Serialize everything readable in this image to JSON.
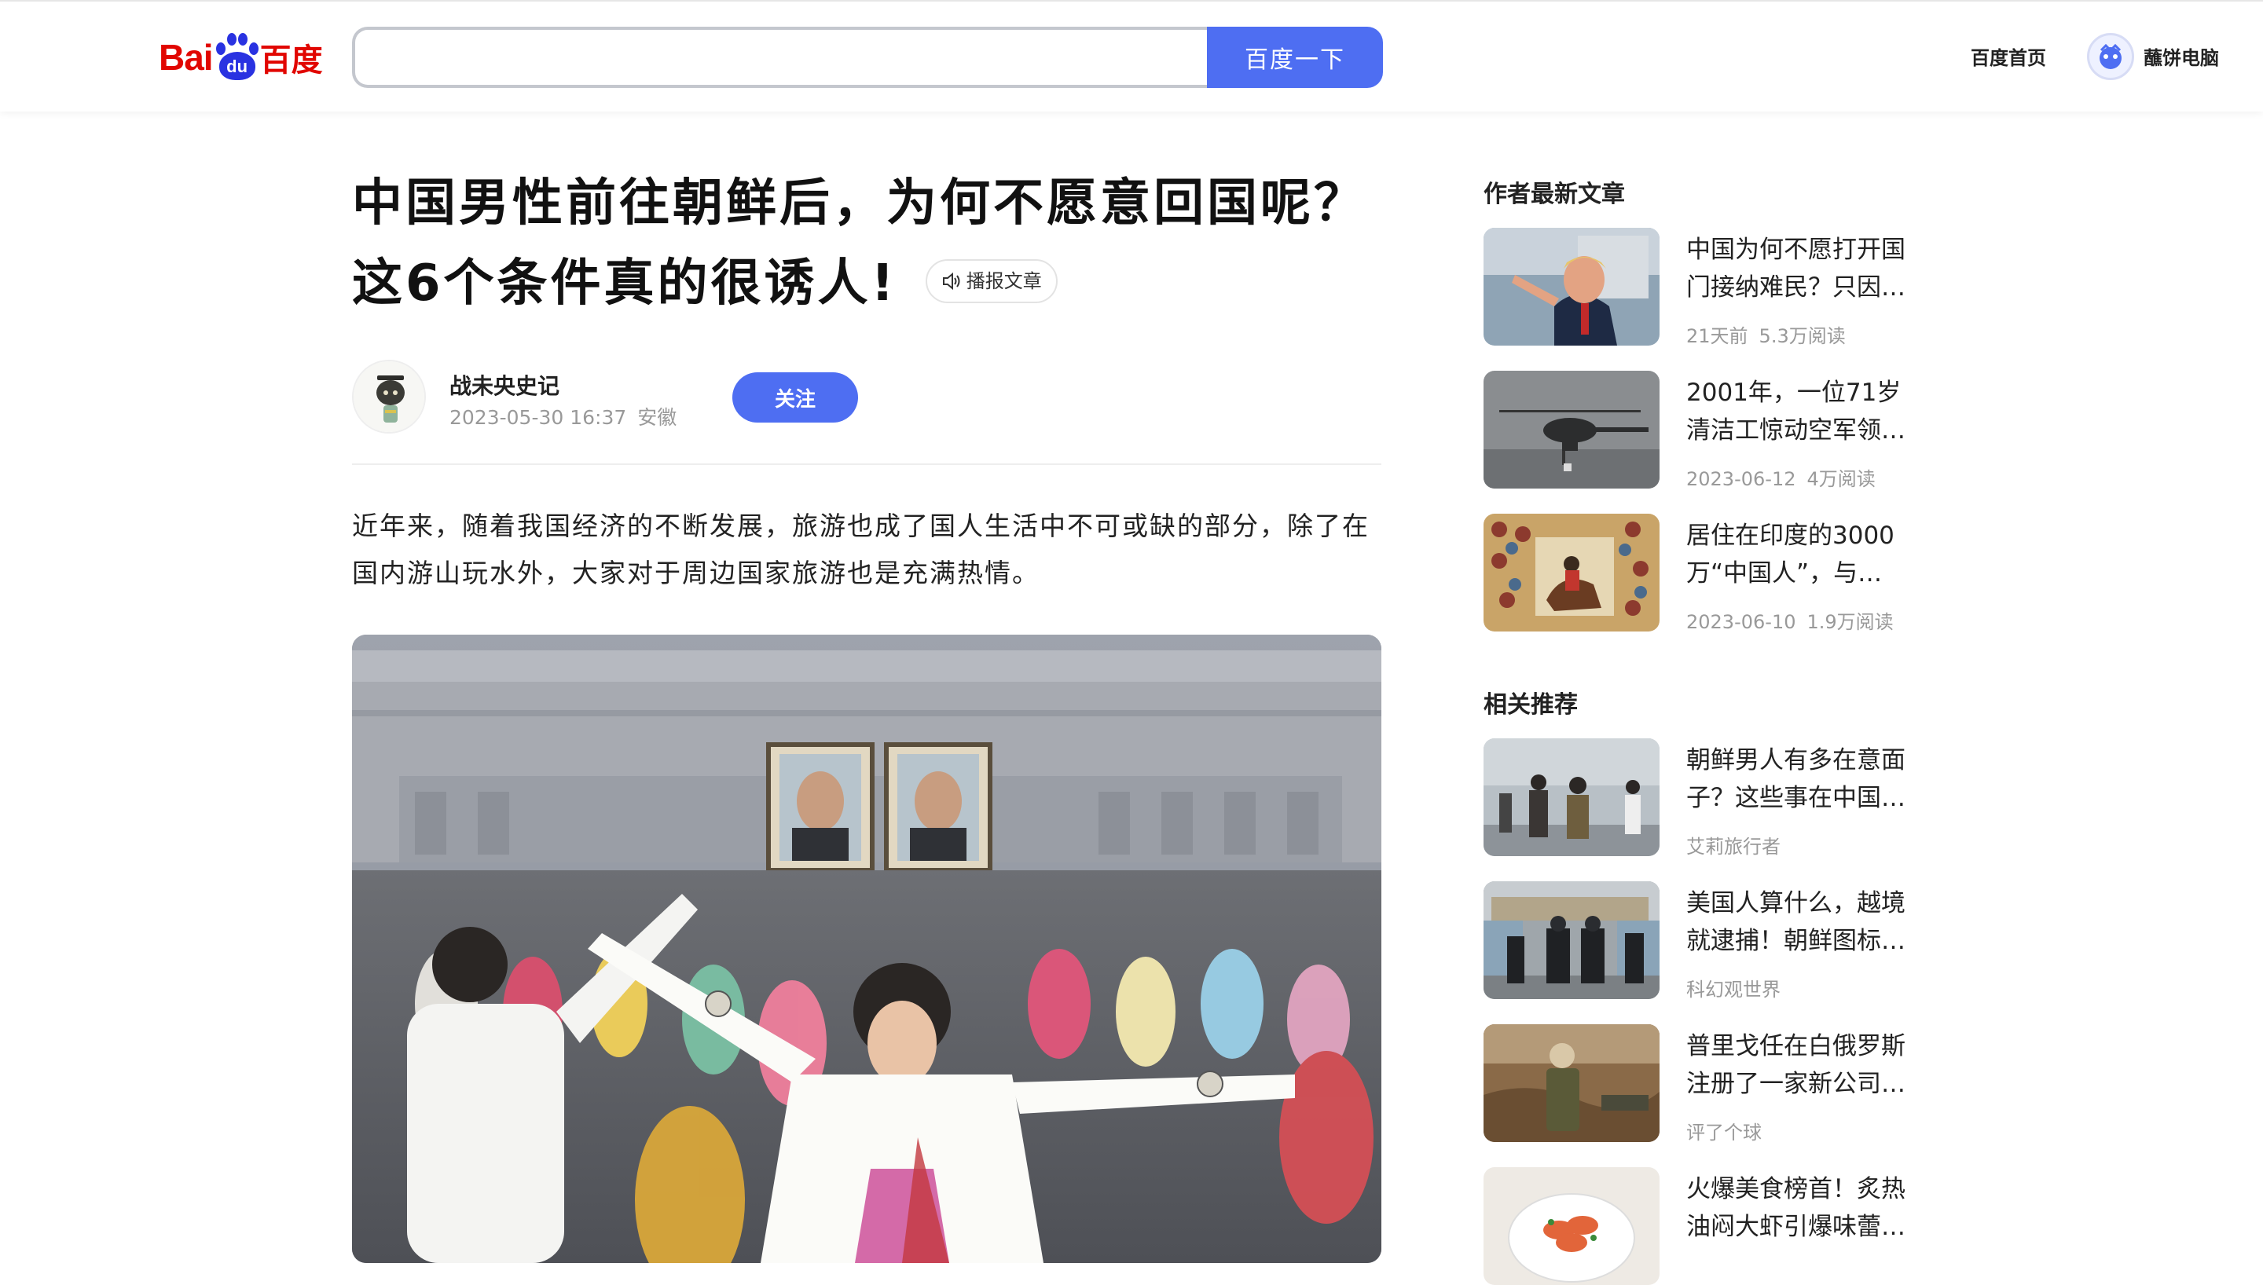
{
  "header": {
    "logo_latin": "Bai",
    "logo_paw_text": "du",
    "logo_cn": "百度",
    "search_placeholder": "",
    "search_button": "百度一下",
    "home_link": "百度首页",
    "user_name": "蘸饼电脑"
  },
  "article": {
    "title": "中国男性前往朝鲜后，为何不愿意回国呢？这6个条件真的很诱人!",
    "listen_button": "播报文章",
    "author": {
      "name": "战未央史记",
      "date": "2023-05-30 16:37",
      "location": "安徽",
      "follow_button": "关注"
    },
    "lead": "近年来，随着我国经济的不断发展，旅游也成了国人生活中不可或缺的部分，除了在国内游山玩水外，大家对于周边国家旅游也是充满热情。"
  },
  "sidebar": {
    "latest_heading": "作者最新文章",
    "latest": [
      {
        "title": "中国为何不愿打开国门接纳难民？只因…",
        "date": "21天前",
        "reads": "5.3万阅读"
      },
      {
        "title": "2001年，一位71岁清洁工惊动空军领…",
        "date": "2023-06-12",
        "reads": "4万阅读"
      },
      {
        "title": "居住在印度的3000万“中国人”，与…",
        "date": "2023-06-10",
        "reads": "1.9万阅读"
      }
    ],
    "related_heading": "相关推荐",
    "related": [
      {
        "title": "朝鲜男人有多在意面子？这些事在中国…",
        "source": "艾莉旅行者"
      },
      {
        "title": "美国人算什么，越境就逮捕！朝鲜图标…",
        "source": "科幻观世界"
      },
      {
        "title": "普里戈任在白俄罗斯注册了一家新公司…",
        "source": "评了个球"
      },
      {
        "title": "火爆美食榜首！炙热油闷大虾引爆味蕾…",
        "source": ""
      }
    ]
  }
}
